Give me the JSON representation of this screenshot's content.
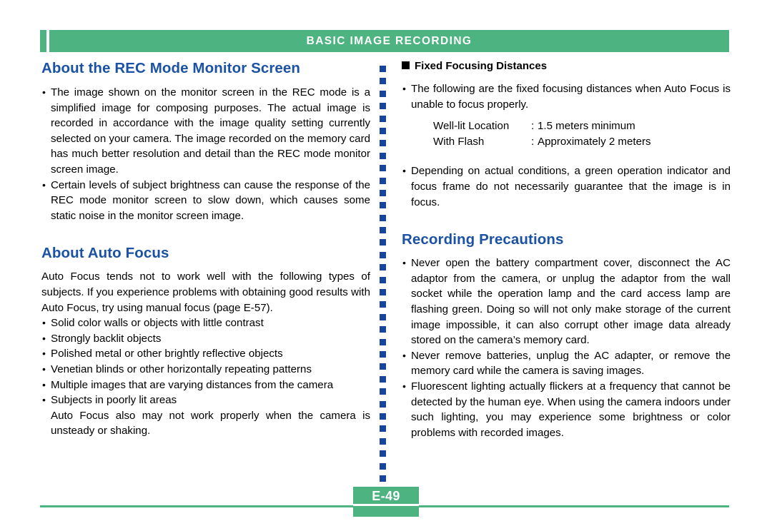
{
  "header": {
    "title": "BASIC IMAGE RECORDING",
    "accent_color": "#4DB381"
  },
  "theme": {
    "green": "#4DB381",
    "heading_blue": "#1B52A5",
    "divider_blue": "#17459B",
    "text_black": "#000000"
  },
  "left_column": {
    "section1": {
      "title": "About the REC Mode Monitor Screen",
      "bullets": [
        "The image shown on the monitor screen in the REC mode is a simplified image for composing purposes.  The actual image is recorded in accordance with the image quality setting currently selected on your camera.  The image recorded on the memory card has much better resolution and detail than the REC mode monitor screen image.",
        "Certain levels of subject brightness can cause the response of the REC mode monitor screen to slow down, which causes some static noise in the monitor screen image."
      ]
    },
    "section2": {
      "title": "About Auto Focus",
      "intro": "Auto Focus tends not to work well with the following types of subjects.  If you experience problems with obtaining good results with Auto Focus, try using manual focus (page E-57).",
      "bullets": [
        "Solid color walls or objects with little contrast",
        "Strongly backlit objects",
        "Polished metal or other brightly reflective objects",
        "Venetian blinds or other horizontally repeating patterns",
        "Multiple images that are varying distances from the camera",
        "Subjects in poorly lit areas"
      ],
      "closing": "Auto Focus also may not work properly when the camera is unsteady or shaking."
    }
  },
  "right_column": {
    "section1": {
      "title": "Fixed Focusing Distances",
      "bullet_icon": "black-square",
      "bullets": [
        "The following are the fixed focusing distances when Auto Focus is unable to focus properly."
      ],
      "distances": [
        {
          "label": "Well-lit Location",
          "colon": ":",
          "value": "1.5 meters minimum"
        },
        {
          "label": "With Flash",
          "colon": ":",
          "value": "Approximately 2 meters"
        }
      ],
      "bullets_after": [
        "Depending on actual conditions, a green operation indicator and focus frame do not necessarily guarantee that the image is in focus."
      ]
    },
    "section2": {
      "title": "Recording Precautions",
      "bullets": [
        "Never open the battery compartment cover, disconnect the AC adaptor from the camera, or unplug the adaptor from the wall socket while the operation lamp and the card access lamp are flashing green.  Doing so will not only make storage of the current image impossible, it can also corrupt other image data already stored on the camera’s memory card.",
        "Never remove batteries, unplug the AC adapter, or remove the memory card while the camera is saving images.",
        "Fluorescent lighting actually flickers at a frequency that cannot be detected by the human eye.  When using the camera indoors under such lighting, you may experience some brightness or color problems with recorded images."
      ]
    }
  },
  "footer": {
    "page_number": "E-49"
  },
  "divider": {
    "dot_count": 34
  }
}
